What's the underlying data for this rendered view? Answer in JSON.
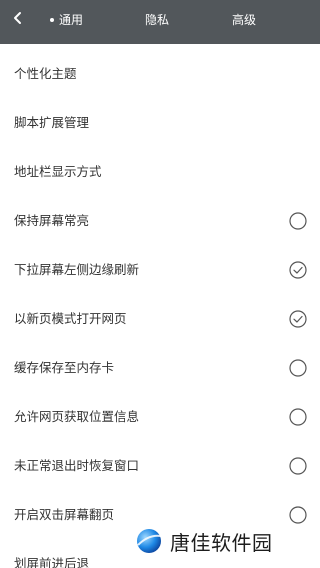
{
  "header": {
    "tabs": [
      "通用",
      "隐私",
      "高级"
    ]
  },
  "settings": {
    "items": [
      {
        "label": "个性化主题"
      },
      {
        "label": "脚本扩展管理"
      },
      {
        "label": "地址栏显示方式"
      },
      {
        "label": "保持屏幕常亮",
        "checked": false
      },
      {
        "label": "下拉屏幕左侧边缘刷新",
        "checked": true
      },
      {
        "label": "以新页模式打开网页",
        "checked": true
      },
      {
        "label": "缓存保存至内存卡",
        "checked": false
      },
      {
        "label": "允许网页获取位置信息",
        "checked": false
      },
      {
        "label": "未正常退出时恢复窗口",
        "checked": false
      },
      {
        "label": "开启双击屏幕翻页",
        "checked": false
      },
      {
        "label": "划屏前进后退"
      }
    ]
  },
  "watermark": {
    "text": "唐佳软件园"
  },
  "colors": {
    "topbar": "#52575b",
    "text": "#333333",
    "check": "#555555"
  }
}
